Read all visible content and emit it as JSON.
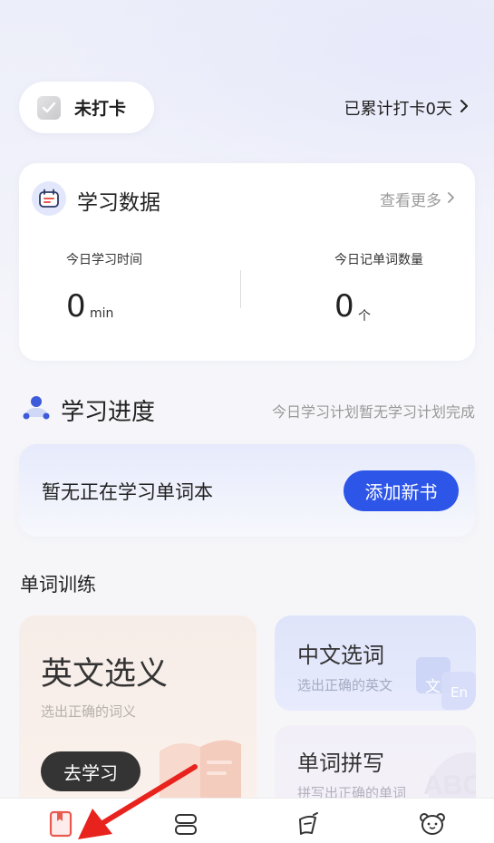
{
  "checkin": {
    "status_label": "未打卡",
    "streak_text": "已累计打卡0天"
  },
  "study_data": {
    "title": "学习数据",
    "more_label": "查看更多",
    "time_label": "今日学习时间",
    "time_value": "0",
    "time_unit": "min",
    "words_label": "今日记单词数量",
    "words_value": "0",
    "words_unit": "个"
  },
  "progress": {
    "title": "学习进度",
    "note": "今日学习计划暂无学习计划完成",
    "empty_text": "暂无正在学习单词本",
    "add_button": "添加新书"
  },
  "training": {
    "title": "单词训练",
    "cards": [
      {
        "title": "英文选义",
        "subtitle": "选出正确的词义",
        "button": "去学习"
      },
      {
        "title": "中文选词",
        "subtitle": "选出正确的英文",
        "deco_a": "文",
        "deco_b": "En"
      },
      {
        "title": "单词拼写",
        "subtitle": "拼写出正确的单词",
        "deco": "ABC"
      }
    ]
  },
  "tabbar": {
    "tabs": [
      {
        "icon": "book-icon",
        "active": true
      },
      {
        "icon": "cards-icon",
        "active": false
      },
      {
        "icon": "notebook-icon",
        "active": false
      },
      {
        "icon": "bear-face-icon",
        "active": false
      }
    ]
  },
  "colors": {
    "accent": "#2d55e8",
    "active_tab": "#e85a4f",
    "arrow": "#e8231e"
  }
}
